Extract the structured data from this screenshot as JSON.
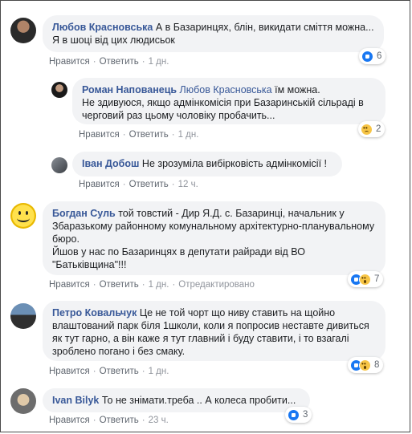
{
  "comments": [
    {
      "author": "Любов Красновська",
      "mention": "",
      "text": "А в Базаринцях, блін, викидати сміття можна... Я в шоці від цих людисьок",
      "actions": [
        "Нравится",
        "Ответить"
      ],
      "time": "1 дн.",
      "edited": "",
      "reactions": [
        "like"
      ],
      "count": "6"
    },
    {
      "author": "Роман Напованець",
      "mention": "Любов Красновська",
      "text": "їм можна.\nНе здивуюся, якщо адмінкомісія при Базаринській сільраді в черговий раз цьому чоловіку пробачить...",
      "actions": [
        "Нравится",
        "Ответить"
      ],
      "time": "1 дн.",
      "edited": "",
      "reactions": [
        "sad"
      ],
      "count": "2"
    },
    {
      "author": "Іван Добош",
      "mention": "",
      "text": "Не зрозуміла вибірковість адмінкомісії !",
      "actions": [
        "Нравится",
        "Ответить"
      ],
      "time": "12 ч.",
      "edited": "",
      "reactions": [],
      "count": ""
    },
    {
      "author": "Богдан Суль",
      "mention": "",
      "text": "той товстий - Дир Я.Д. с. Базаринці, начальник у Збаразькому районному комунальному архітектурно-планувальному бюро.\nЙшов у нас по Базаринцях в депутати райради від ВО \"Батьківщина\"!!!",
      "actions": [
        "Нравится",
        "Ответить"
      ],
      "time": "1 дн.",
      "edited": "Отредактировано",
      "reactions": [
        "like",
        "wow"
      ],
      "count": "7"
    },
    {
      "author": "Петро Ковальчук",
      "mention": "",
      "text": "Це не той чорт що ниву ставить на щойно влаштований парк біля 1школи, коли я попросив неставте дивиться як тут гарно, а він каже я тут главний і буду ставити, і то взагалі зроблено погано і без смаку.",
      "actions": [
        "Нравится",
        "Ответить"
      ],
      "time": "1 дн.",
      "edited": "",
      "reactions": [
        "like",
        "wow"
      ],
      "count": "8"
    },
    {
      "author": "Ivan Bilyk",
      "mention": "",
      "text": "То не знімати.треба .. А колеса пробити...",
      "actions": [
        "Нравится",
        "Ответить"
      ],
      "time": "23 ч.",
      "edited": "",
      "reactions": [
        "like"
      ],
      "count": "3"
    }
  ]
}
